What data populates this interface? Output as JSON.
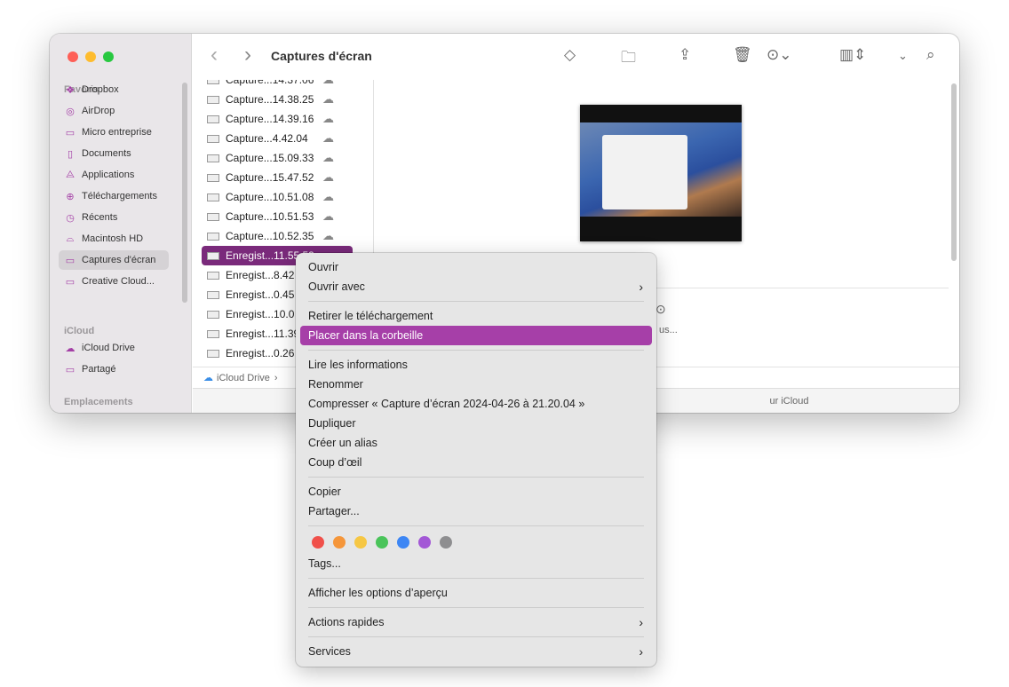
{
  "window": {
    "title": "Captures d'écran",
    "lights": [
      "#fe5f57",
      "#febc2e",
      "#28c840"
    ]
  },
  "sidebar": {
    "favoris_label": "Favoris",
    "favoris": [
      {
        "label": "Dropbox",
        "icon": "dropbox-icon",
        "glyph": "❖"
      },
      {
        "label": "AirDrop",
        "icon": "airdrop-icon",
        "glyph": "◎"
      },
      {
        "label": "Micro entreprise",
        "icon": "folder-icon",
        "glyph": "▭"
      },
      {
        "label": "Documents",
        "icon": "document-icon",
        "glyph": "▯"
      },
      {
        "label": "Applications",
        "icon": "applications-icon",
        "glyph": "⨺"
      },
      {
        "label": "Téléchargements",
        "icon": "download-icon",
        "glyph": "⊕"
      },
      {
        "label": "Récents",
        "icon": "clock-icon",
        "glyph": "◷"
      },
      {
        "label": "Macintosh HD",
        "icon": "disk-icon",
        "glyph": "⌓"
      },
      {
        "label": "Captures d'écran",
        "icon": "folder-icon",
        "glyph": "▭",
        "selected": true
      },
      {
        "label": "Creative Cloud...",
        "icon": "folder-icon",
        "glyph": "▭"
      }
    ],
    "icloud_label": "iCloud",
    "icloud": [
      {
        "label": "iCloud Drive",
        "icon": "cloud-icon",
        "glyph": "☁"
      },
      {
        "label": "Partagé",
        "icon": "shared-folder-icon",
        "glyph": "▭"
      }
    ],
    "emplacements_label": "Emplacements"
  },
  "toolbar": {
    "back": "‹",
    "forward": "›",
    "icons": [
      "tag-icon",
      "new-folder-icon",
      "share-icon",
      "trash-icon",
      "more-icon",
      "column-view-icon",
      "chevron-down-icon",
      "search-icon"
    ]
  },
  "files": [
    {
      "name": "Capture...14.37.06"
    },
    {
      "name": "Capture...14.38.25"
    },
    {
      "name": "Capture...14.39.16"
    },
    {
      "name": "Capture...4.42.04"
    },
    {
      "name": "Capture...15.09.33"
    },
    {
      "name": "Capture...15.47.52"
    },
    {
      "name": "Capture...10.51.08"
    },
    {
      "name": "Capture...10.51.53"
    },
    {
      "name": "Capture...10.52.35"
    },
    {
      "name": "Enregist...11.55.53",
      "selected": true
    },
    {
      "name": "Enregist...8.42"
    },
    {
      "name": "Enregist...0.45"
    },
    {
      "name": "Enregist...10.0"
    },
    {
      "name": "Enregist...11.39"
    },
    {
      "name": "Enregist...0.26"
    }
  ],
  "preview": {
    "more_label": "us..."
  },
  "pathbar": {
    "root": "iCloud Drive",
    "sep": "›"
  },
  "status": {
    "text": "ur iCloud"
  },
  "menu": {
    "groups": [
      [
        {
          "label": "Ouvrir"
        },
        {
          "label": "Ouvrir avec",
          "submenu": true
        }
      ],
      [
        {
          "label": "Retirer le téléchargement"
        },
        {
          "label": "Placer dans la corbeille",
          "highlighted": true
        }
      ],
      [
        {
          "label": "Lire les informations"
        },
        {
          "label": "Renommer"
        },
        {
          "label": "Compresser « Capture d’écran 2024-04-26 à 21.20.04 »"
        },
        {
          "label": "Dupliquer"
        },
        {
          "label": "Créer un alias"
        },
        {
          "label": "Coup d’œil"
        }
      ],
      [
        {
          "label": "Copier"
        },
        {
          "label": "Partager..."
        }
      ]
    ],
    "tag_colors": [
      "#f0504a",
      "#f5963a",
      "#f6c744",
      "#4ac45a",
      "#3d86f4",
      "#a358d6",
      "#8e8e90"
    ],
    "tags_label": "Tags...",
    "apercu_label": "Afficher les options d’aperçu",
    "actions_label": "Actions rapides",
    "services_label": "Services",
    "submenu_glyph": "›"
  }
}
